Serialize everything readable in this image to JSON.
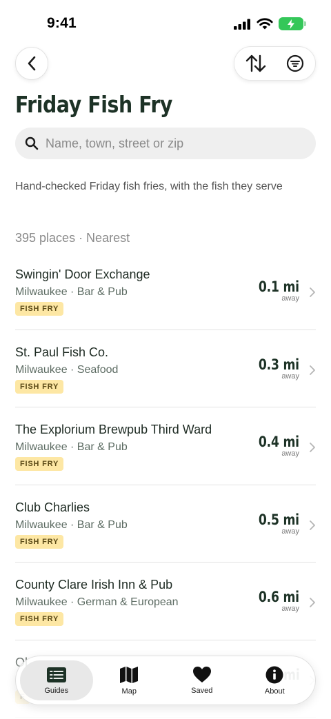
{
  "status_bar": {
    "time": "9:41",
    "icons": [
      "cellular-signal-icon",
      "wifi-icon",
      "battery-charging-icon"
    ],
    "battery_color": "#34c759"
  },
  "header": {
    "back_icon": "chevron-left-icon",
    "sort_icon": "sort-arrows-icon",
    "filter_icon": "filter-icon",
    "title": "Friday Fish Fry"
  },
  "search": {
    "placeholder": "Name, town, street or zip",
    "value": ""
  },
  "subtitle": "Hand-checked Friday fish fries, with the fish they serve",
  "list_meta": "395 places · Nearest",
  "colors": {
    "title": "#1d3226",
    "tag_background": "#fde7a4",
    "tag_text": "#5b4a17"
  },
  "places": [
    {
      "name": "Swingin' Door Exchange",
      "meta": "Milwaukee · Bar & Pub",
      "tag": "FISH FRY",
      "distance": "0.1 mi",
      "away": "away"
    },
    {
      "name": "St. Paul Fish Co.",
      "meta": "Milwaukee · Seafood",
      "tag": "FISH FRY",
      "distance": "0.3 mi",
      "away": "away"
    },
    {
      "name": "The Explorium Brewpub Third Ward",
      "meta": "Milwaukee · Bar & Pub",
      "tag": "FISH FRY",
      "distance": "0.4 mi",
      "away": "away"
    },
    {
      "name": "Club Charlies",
      "meta": "Milwaukee · Bar & Pub",
      "tag": "FISH FRY",
      "distance": "0.5 mi",
      "away": "away"
    },
    {
      "name": "County Clare Irish Inn & Pub",
      "meta": "Milwaukee · German & European",
      "tag": "FISH FRY",
      "distance": "0.6 mi",
      "away": "away"
    },
    {
      "name": "Ol",
      "meta": "",
      "tag": "F",
      "distance": "mi",
      "away": ""
    }
  ],
  "tabs": [
    {
      "label": "Guides",
      "icon": "guides-list-icon",
      "active": true
    },
    {
      "label": "Map",
      "icon": "map-icon",
      "active": false
    },
    {
      "label": "Saved",
      "icon": "heart-icon",
      "active": false
    },
    {
      "label": "About",
      "icon": "info-icon",
      "active": false
    }
  ]
}
